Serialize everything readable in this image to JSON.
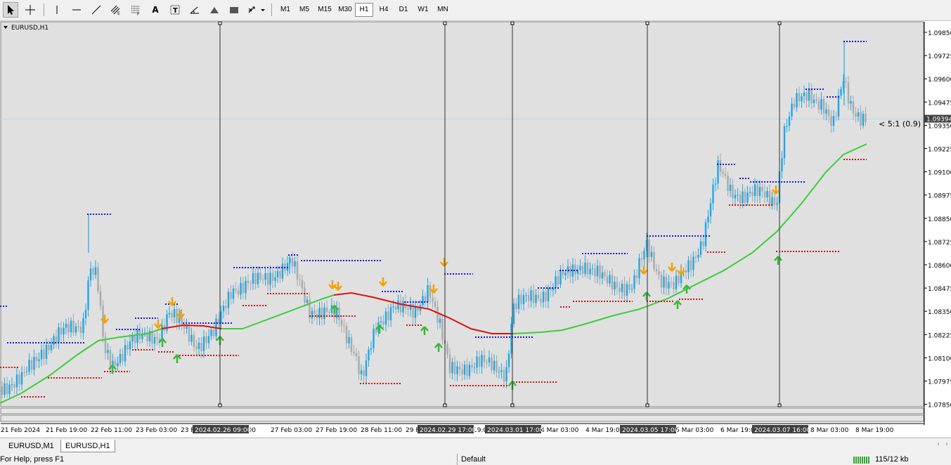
{
  "toolbar": {
    "tools": [
      {
        "name": "cursor-icon"
      },
      {
        "name": "crosshair-icon"
      },
      {
        "name": "vertical-line-icon"
      },
      {
        "name": "horizontal-line-icon"
      },
      {
        "name": "trendline-icon"
      },
      {
        "name": "equidistant-channel-icon"
      },
      {
        "name": "fibonacci-icon"
      },
      {
        "name": "text-icon"
      },
      {
        "name": "text-label-icon"
      },
      {
        "name": "angle-line-icon"
      },
      {
        "name": "triangle-icon"
      },
      {
        "name": "rectangle-icon"
      },
      {
        "name": "arrows-dropdown-icon"
      }
    ],
    "timeframes": [
      "M1",
      "M5",
      "M15",
      "M30",
      "H1",
      "H4",
      "D1",
      "W1",
      "MN"
    ],
    "active_timeframe": "H1"
  },
  "chart": {
    "symbol_label": "EURUSD,H1",
    "price_labels": [
      "1.09850",
      "1.09725",
      "1.09600",
      "1.09475",
      "1.09350",
      "1.09225",
      "1.09100",
      "1.08975",
      "1.08850",
      "1.08725",
      "1.08600",
      "1.08475",
      "1.08350",
      "1.08225",
      "1.08100",
      "1.07975",
      "1.07850"
    ],
    "current_price": "1.09394",
    "rr_label": "< 5:1 (0.9)",
    "time_labels": [
      "21 Feb 2024",
      "21 Feb 19:00",
      "22 Feb 11:00",
      "23 Feb 03:00",
      "23 F",
      "11:00",
      "27 Feb 03:00",
      "27 Feb 19:00",
      "28 Feb 11:00",
      "29 F",
      "19:0",
      "4 Mar 03:00",
      "4 Mar 19:00",
      "5 Mar 03:00",
      "6 Mar 19:00",
      "8 Mar 03:00",
      "8 Mar 19:00"
    ],
    "vline_labels": [
      "2024.02.26 09:00",
      "2024.02.29 17:00",
      "2024.03.01 17:00",
      "2024.03.05 17:00",
      "2024.03.07 16:00"
    ],
    "colors": {
      "bull": "#1ea7e6",
      "bear": "#a9a9a9",
      "ma_up": "#3ccd3c",
      "ma_down": "#dd1111",
      "resistance": "#1a1acc",
      "support": "#c01818",
      "arrow_up": "#3ab83a",
      "arrow_down": "#f5a000",
      "background": "#e0e0e0"
    }
  },
  "tabs": [
    "EURUSD,M1",
    "EURUSD,H1"
  ],
  "active_tab": "EURUSD,H1",
  "status": {
    "help": "For Help, press F1",
    "profile": "Default",
    "traffic": "115/12 kb"
  }
}
